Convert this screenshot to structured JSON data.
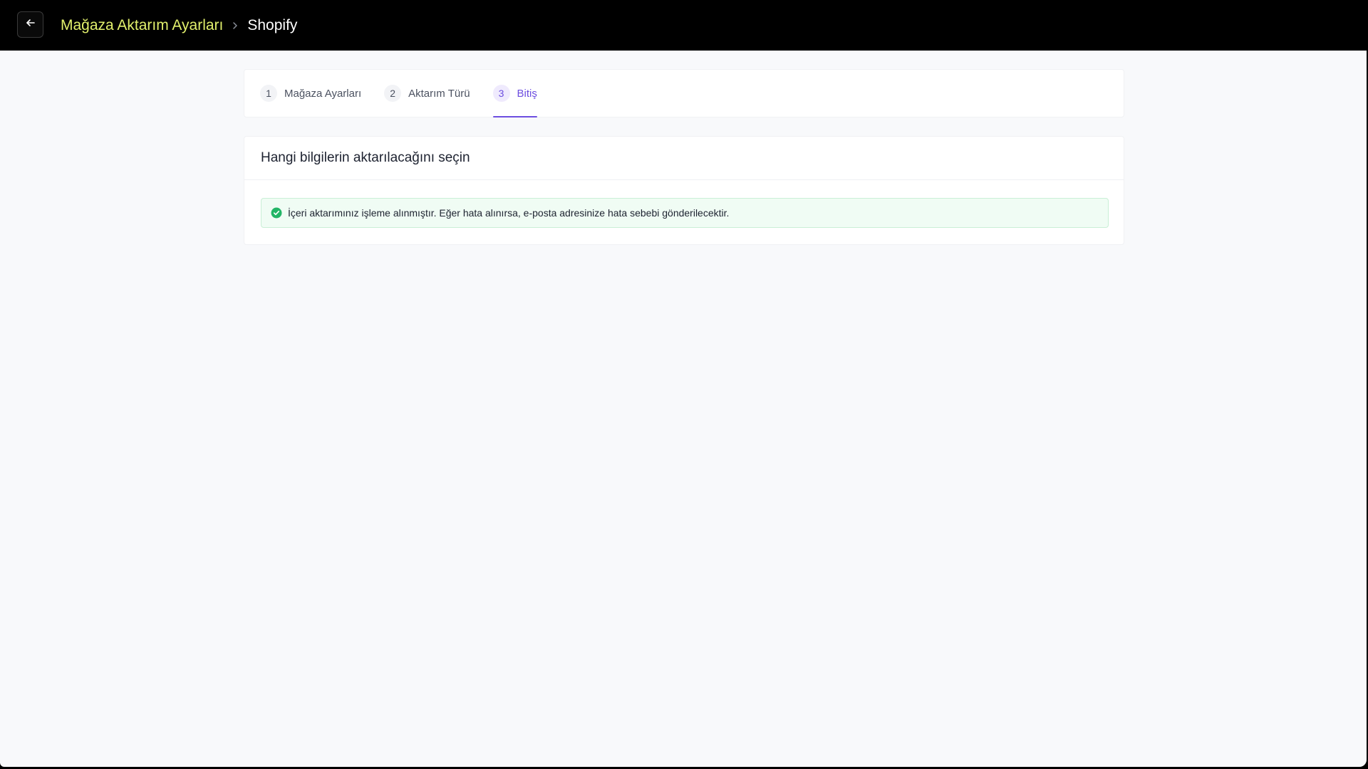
{
  "header": {
    "back_icon": "arrow-left-icon",
    "breadcrumb_parent": "Mağaza Aktarım Ayarları",
    "breadcrumb_separator_icon": "chevron-right-icon",
    "breadcrumb_current": "Shopify"
  },
  "steps": [
    {
      "number": "1",
      "label": "Mağaza Ayarları",
      "active": false
    },
    {
      "number": "2",
      "label": "Aktarım Türü",
      "active": false
    },
    {
      "number": "3",
      "label": "Bitiş",
      "active": true
    }
  ],
  "card": {
    "title": "Hangi bilgilerin aktarılacağını seçin",
    "alert": {
      "icon": "check-circle-icon",
      "message": "İçeri aktarımınız işleme alınmıştır. Eğer hata alınırsa, e-posta adresinize hata sebebi gönderilecektir."
    }
  },
  "colors": {
    "accent": "#6d4ee0",
    "breadcrumb_link": "#e2f06c",
    "success": "#22b566",
    "topbar": "#000000"
  }
}
